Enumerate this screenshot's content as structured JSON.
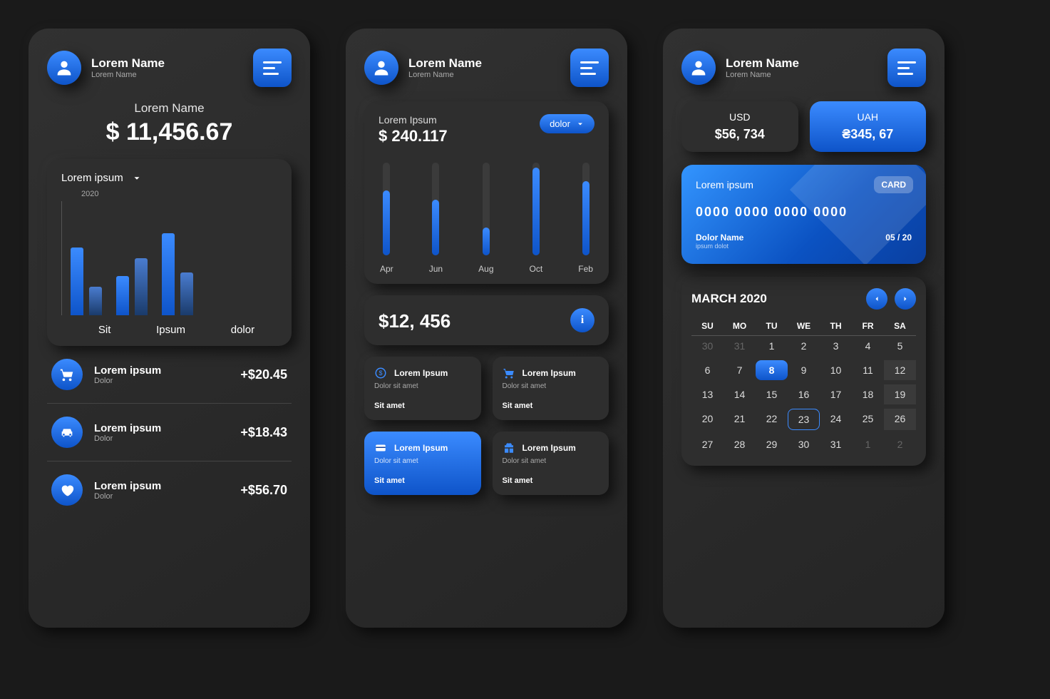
{
  "header": {
    "name": "Lorem Name",
    "sub": "Lorem Name"
  },
  "screen1": {
    "balanceLabel": "Lorem Name",
    "balanceValue": "$ 11,456.67",
    "chart": {
      "dropdown": "Lorem ipsum",
      "year": "2020",
      "catLabels": [
        "Sit",
        "Ipsum",
        "dolor"
      ]
    },
    "tx": [
      {
        "icon": "cart",
        "title": "Lorem ipsum",
        "sub": "Dolor",
        "amt": "+$20.45"
      },
      {
        "icon": "car",
        "title": "Lorem ipsum",
        "sub": "Dolor",
        "amt": "+$18.43"
      },
      {
        "icon": "heart",
        "title": "Lorem ipsum",
        "sub": "Dolor",
        "amt": "+$56.70"
      }
    ]
  },
  "screen2": {
    "topLabel": "Lorem Ipsum",
    "topAmt": "$ 240.117",
    "pill": "dolor",
    "months": [
      "Apr",
      "Jun",
      "Aug",
      "Oct",
      "Feb"
    ],
    "bigAmt": "$12, 456",
    "cards": [
      {
        "icon": "dollar",
        "title": "Lorem Ipsum",
        "sub": "Dolor sit amet",
        "foot": "Sit amet",
        "active": false
      },
      {
        "icon": "cart",
        "title": "Lorem Ipsum",
        "sub": "Dolor sit amet",
        "foot": "Sit amet",
        "active": false
      },
      {
        "icon": "card",
        "title": "Lorem Ipsum",
        "sub": "Dolor sit amet",
        "foot": "Sit amet",
        "active": true
      },
      {
        "icon": "gift",
        "title": "Lorem Ipsum",
        "sub": "Dolor sit amet",
        "foot": "Sit amet",
        "active": false
      }
    ]
  },
  "screen3": {
    "usdLabel": "USD",
    "usdVal": "$56, 734",
    "uahLabel": "UAH",
    "uahVal": "₴345, 67",
    "card": {
      "title": "Lorem ipsum",
      "badge": "CARD",
      "num": "0000 0000 0000 0000",
      "holder": "Dolor Name",
      "sub": "ipsum dolot",
      "exp": "05 / 20"
    },
    "cal": {
      "title": "MARCH 2020",
      "dow": [
        "SU",
        "MO",
        "TU",
        "WE",
        "TH",
        "FR",
        "SA"
      ],
      "days": [
        {
          "n": "30",
          "c": "dim"
        },
        {
          "n": "31",
          "c": "dim"
        },
        {
          "n": "1"
        },
        {
          "n": "2"
        },
        {
          "n": "3"
        },
        {
          "n": "4"
        },
        {
          "n": "5"
        },
        {
          "n": "6"
        },
        {
          "n": "7"
        },
        {
          "n": "8",
          "c": "sel"
        },
        {
          "n": "9"
        },
        {
          "n": "10"
        },
        {
          "n": "11"
        },
        {
          "n": "12",
          "c": "wk"
        },
        {
          "n": "13"
        },
        {
          "n": "14"
        },
        {
          "n": "15"
        },
        {
          "n": "16"
        },
        {
          "n": "17"
        },
        {
          "n": "18"
        },
        {
          "n": "19",
          "c": "wk"
        },
        {
          "n": "20"
        },
        {
          "n": "21"
        },
        {
          "n": "22"
        },
        {
          "n": "23",
          "c": "today"
        },
        {
          "n": "24"
        },
        {
          "n": "25"
        },
        {
          "n": "26",
          "c": "wk"
        },
        {
          "n": "27"
        },
        {
          "n": "28"
        },
        {
          "n": "29"
        },
        {
          "n": "30"
        },
        {
          "n": "31"
        },
        {
          "n": "1",
          "c": "dim"
        },
        {
          "n": "2",
          "c": "dim"
        }
      ]
    }
  },
  "chart_data": [
    {
      "type": "bar",
      "title": "Lorem ipsum 2020",
      "categories": [
        "Sit",
        "Ipsum",
        "dolor"
      ],
      "series": [
        {
          "name": "a",
          "values": [
            95,
            55,
            115
          ]
        },
        {
          "name": "b",
          "values": [
            40,
            80,
            60
          ]
        }
      ],
      "xlabel": "",
      "ylabel": "",
      "ylim": [
        0,
        140
      ]
    },
    {
      "type": "bar",
      "title": "Monthly",
      "categories": [
        "Apr",
        "Jun",
        "Aug",
        "Oct",
        "Feb"
      ],
      "values": [
        70,
        60,
        30,
        95,
        80
      ],
      "xlabel": "",
      "ylabel": "",
      "ylim": [
        0,
        100
      ]
    }
  ]
}
